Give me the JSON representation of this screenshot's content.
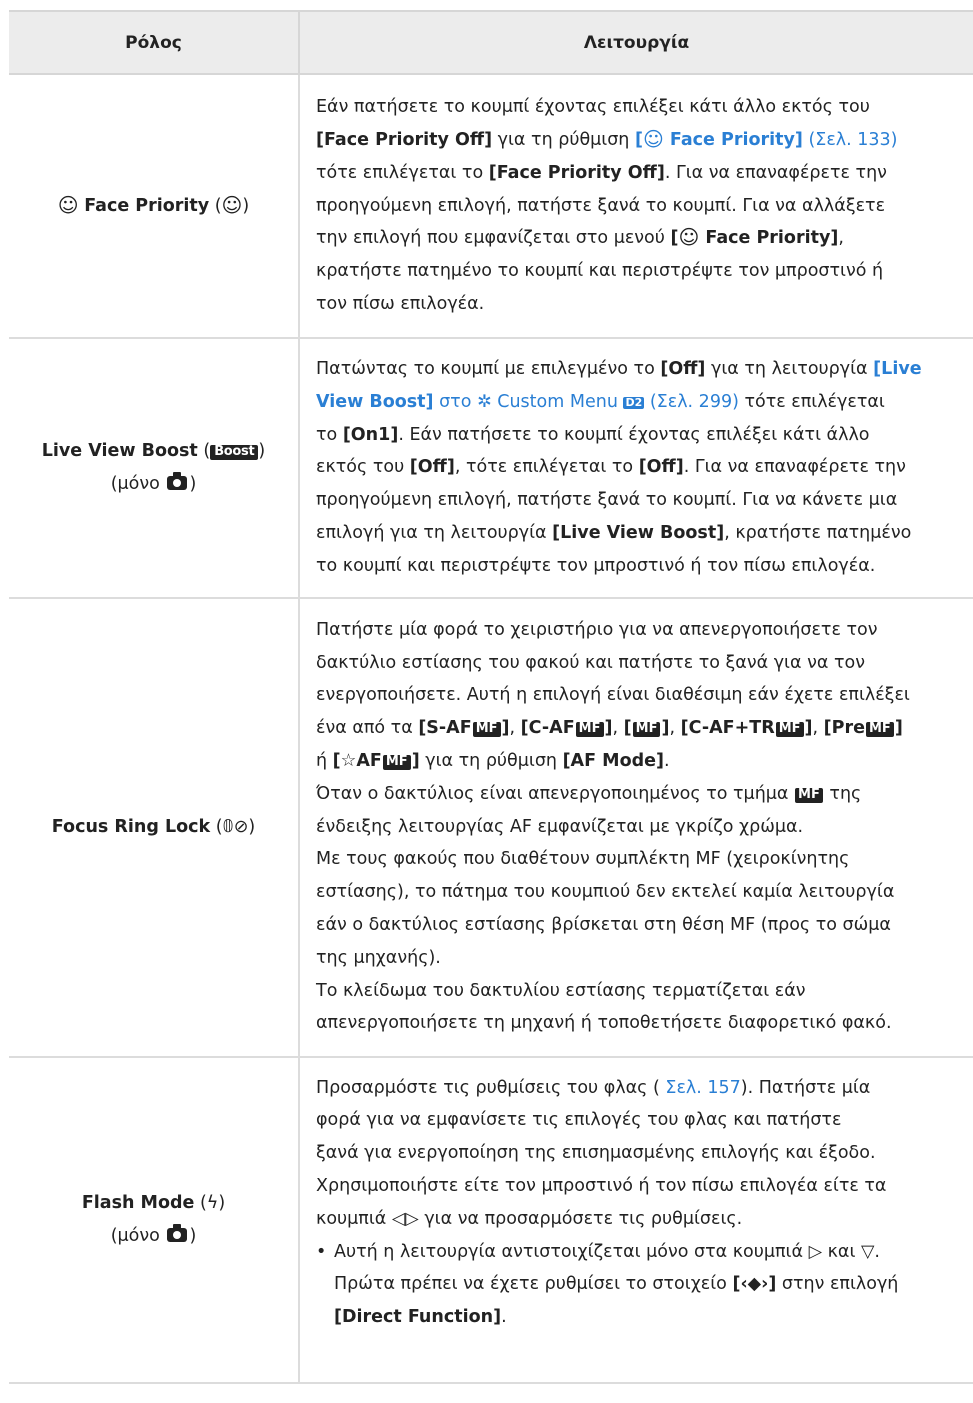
{
  "header": {
    "col1": "Ρόλος",
    "col2": "Λειτουργία"
  },
  "rows": {
    "face": {
      "role_name": "Face Priority",
      "func": {
        "t1": "Εάν πατήσετε το κουμπί έχοντας επιλέξει κάτι άλλο εκτός του",
        "b1": "[Face Priority Off]",
        "t2": " για τη ρύθμιση ",
        "link1": "Face Priority]",
        "page1": "(Σελ. 133)",
        "t3": "τότε επιλέγεται το ",
        "b2": "[Face Priority Off]",
        "t4": ". Για να επαναφέρετε την",
        "t5": "προηγούμενη επιλογή, πατήστε ξανά το κουμπί. Για να αλλάξετε",
        "t6": "την επιλογή που εμφανίζεται στο μενού ",
        "b3": "Face Priority]",
        "t7": ",",
        "t8": "κρατήστε πατημένο το κουμπί και περιστρέψτε τον μπροστινό ή",
        "t9": "τον πίσω επιλογέα."
      }
    },
    "boost": {
      "role_name": "Live View Boost",
      "role_icon": "Boost",
      "role_only": "μόνο",
      "func": {
        "t1": "Πατώντας το κουμπί με επιλεγμένο το ",
        "b1": "[Off]",
        "t2": " για τη λειτουργία ",
        "link1a": "[Live",
        "link1b": "View Boost]",
        "t3": " στο ",
        "menu": "Custom Menu",
        "menu_tab": "D2",
        "page1": "(Σελ. 299)",
        "t4": " τότε επιλέγεται",
        "t5": "το ",
        "b2": "[On1]",
        "t6": ". Εάν πατήσετε το κουμπί έχοντας επιλέξει κάτι άλλο",
        "t7": "εκτός του ",
        "b3": "[Off]",
        "t8": ", τότε επιλέγεται το ",
        "b4": "[Off]",
        "t9": ". Για να επαναφέρετε την",
        "t10": "προηγούμενη επιλογή, πατήστε ξανά το κουμπί. Για να κάνετε μια",
        "t11": "επιλογή για τη λειτουργία ",
        "b5": "[Live View Boost]",
        "t12": ", κρατήστε πατημένο",
        "t13": "το κουμπί και περιστρέψτε τον μπροστινό ή τον πίσω επιλογέα."
      }
    },
    "ring": {
      "role_name": "Focus Ring Lock",
      "role_symbol": "(𝟘⊘)",
      "func": {
        "t1": "Πατήστε μία φορά το χειριστήριο για να απενεργοποιήσετε τον",
        "t2": "δακτύλιο εστίασης του φακού και πατήστε το ξανά για να τον",
        "t3": "ενεργοποιήσετε. Αυτή η επιλογή είναι διαθέσιμη εάν έχετε επιλέξει",
        "t4": "ένα από τα ",
        "m1": "[S-AF",
        "m2": "[C-AF",
        "m3": "[",
        "m4": "[C-AF+TR",
        "m5": "[Pre",
        "mf": "MF",
        "t5": "ή ",
        "m6a": "[",
        "m6star": "☆",
        "m6b": "AF",
        "t6": " για τη ρύθμιση ",
        "b1": "[AF Mode]",
        "t7": "Όταν ο δακτύλιος είναι απενεργοποιημένος το τμήμα ",
        "t8": " της",
        "t9": "ένδειξης λειτουργίας AF εμφανίζεται με γκρίζο χρώμα.",
        "t10": "Με τους φακούς που διαθέτουν συμπλέκτη MF (χειροκίνητης",
        "t11": "εστίασης), το πάτημα του κουμπιού δεν εκτελεί καμία λειτουργία",
        "t12": "εάν ο δακτύλιος εστίασης βρίσκεται στη θέση MF (προς το σώμα",
        "t13": "της μηχανής).",
        "t14": "Το κλείδωμα του δακτυλίου εστίασης τερματίζεται εάν",
        "t15": "απενεργοποιήσετε τη μηχανή ή τοποθετήσετε διαφορετικό φακό."
      }
    },
    "flash": {
      "role_name": "Flash Mode",
      "role_symbol": "ϟ",
      "role_only": "μόνο",
      "func": {
        "t1": "Προσαρμόστε τις ρυθμίσεις του φλας ( ",
        "page1": "Σελ. 157",
        "t2": "). Πατήστε μία",
        "t3": "φορά για να εμφανίσετε τις επιλογές του φλας και πατήστε",
        "t4": "ξανά για ενεργοποίηση της επισημασμένης επιλογής και έξοδο.",
        "t5": "Χρησιμοποιήστε είτε τον μπροστινό ή τον πίσω επιλογέα είτε τα",
        "t6": "κουμπιά ",
        "arrows": "◁▷",
        "t7": " για να προσαρμόσετε τις ρυθμίσεις.",
        "bullet": "•",
        "t8": "Αυτή η λειτουργία αντιστοιχίζεται μόνο στα κουμπιά ",
        "right_arrow": "▷",
        "t9": " και ",
        "down_arrow": "▽",
        "t10": "Πρώτα πρέπει να έχετε ρυθμίσει το στοιχείο ",
        "b1": "[‹◆›]",
        "t11": " στην επιλογή",
        "b2": "[Direct Function]"
      }
    }
  },
  "colors": {
    "link": "#2a7fd4",
    "header_bg": "#ececec",
    "text": "#222222"
  }
}
